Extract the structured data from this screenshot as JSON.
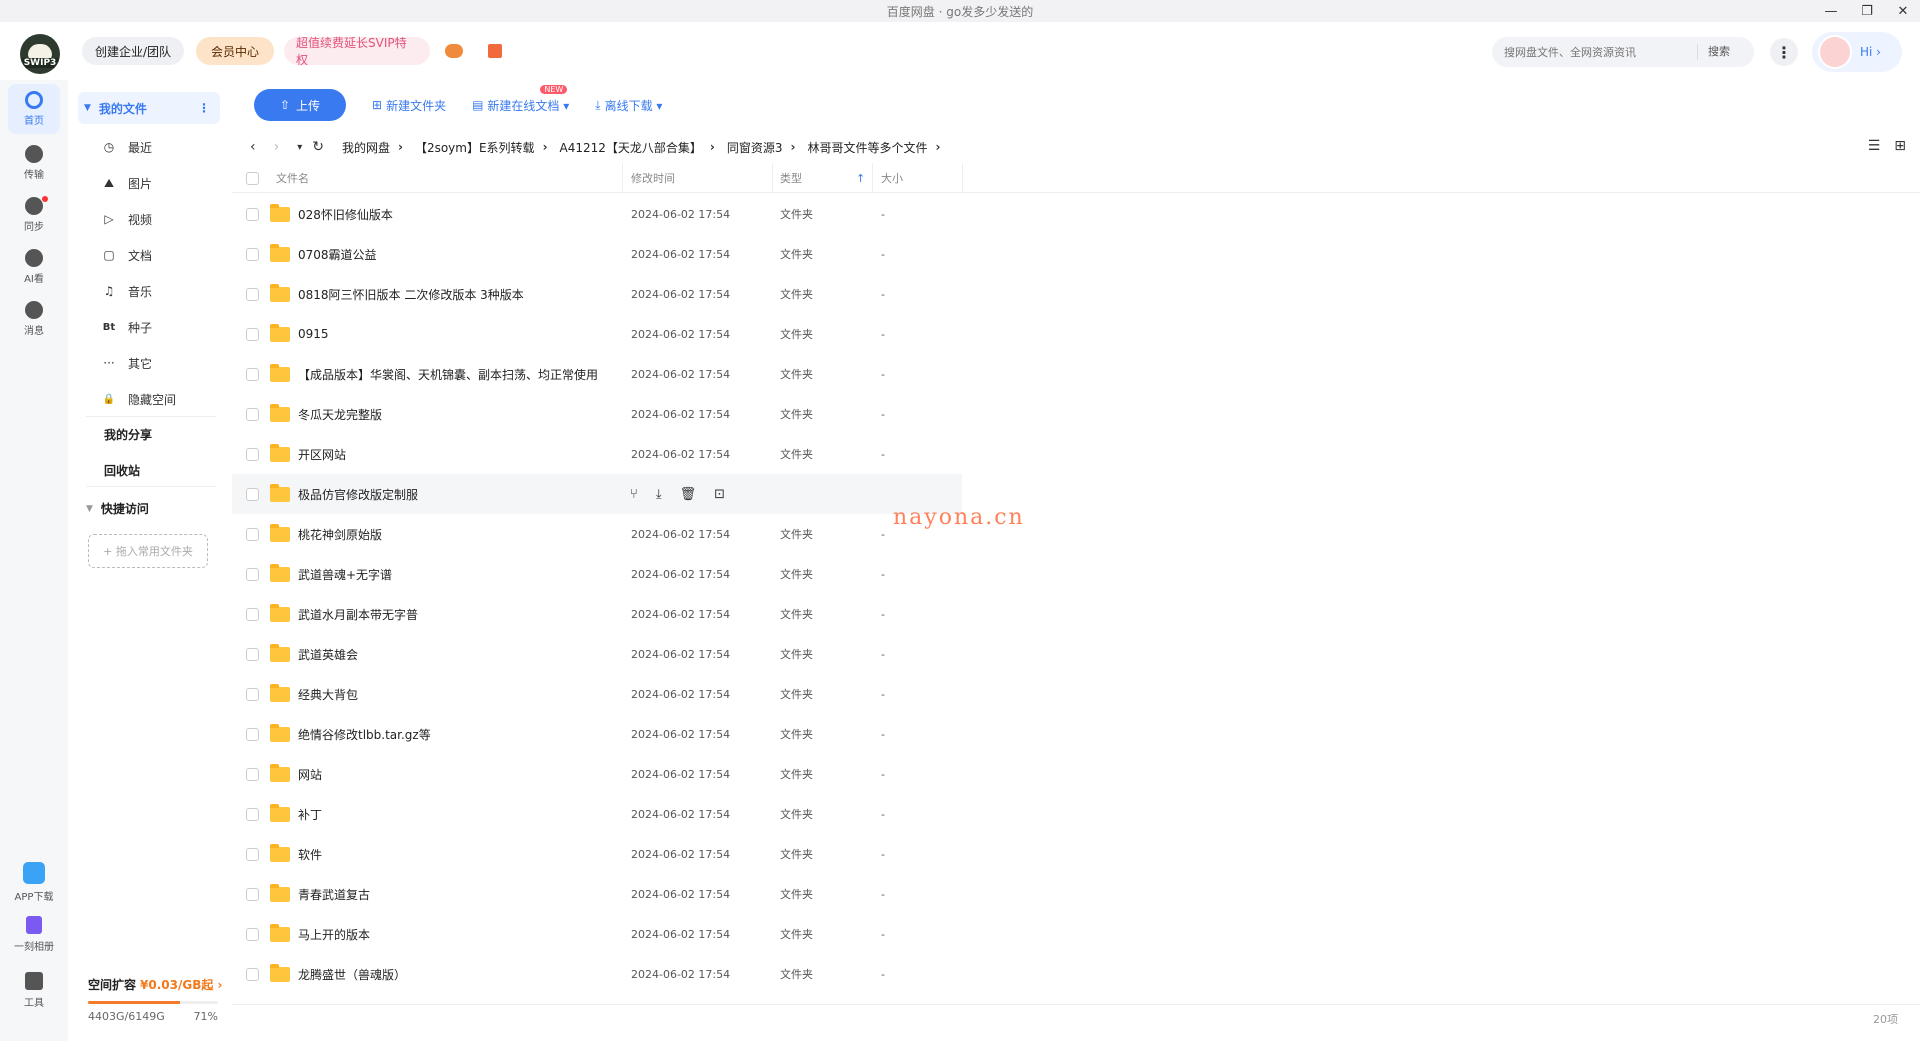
{
  "window": {
    "title": "百度网盘 · go发多少发送的",
    "controls": [
      "—",
      "❐",
      "✕"
    ]
  },
  "topbar": {
    "logo_badge": "SWIP3",
    "team_label": "创建企业/团队",
    "vip_label": "会员中心",
    "svip_label": "超值续费延长SVIP特权",
    "search_placeholder": "搜网盘文件、全网资源资讯",
    "search_button": "搜索",
    "more_icon": "⋮",
    "hi_label": "Hi ›"
  },
  "rail": {
    "items": [
      {
        "label": "首页",
        "icon": "home-icon"
      },
      {
        "label": "传输",
        "icon": "transfer-icon"
      },
      {
        "label": "同步",
        "icon": "sync-icon"
      },
      {
        "label": "AI看",
        "icon": "ai-icon"
      },
      {
        "label": "消息",
        "icon": "message-icon"
      }
    ],
    "bottom": [
      {
        "label": "APP下载",
        "icon": "app-download-icon"
      },
      {
        "label": "一刻相册",
        "icon": "album-icon"
      },
      {
        "label": "工具",
        "icon": "tools-icon"
      }
    ]
  },
  "sidebar": {
    "my_files": "我的文件",
    "categories": [
      {
        "label": "最近",
        "icon": "◷"
      },
      {
        "label": "图片",
        "icon": "⛰"
      },
      {
        "label": "视频",
        "icon": "▷"
      },
      {
        "label": "文档",
        "icon": "▢"
      },
      {
        "label": "音乐",
        "icon": "♫"
      },
      {
        "label": "种子",
        "icon": "Bt"
      },
      {
        "label": "其它",
        "icon": "···"
      },
      {
        "label": "隐藏空间",
        "icon": "🔒"
      }
    ],
    "my_share": "我的分享",
    "recycle_bin": "回收站",
    "quick_access": "快捷访问",
    "drag_hint": "+ 拖入常用文件夹",
    "storage": {
      "title": "空间扩容",
      "price": "¥0.03/GB起 ›",
      "used": "4403G/6149G",
      "percent_label": "71%",
      "percent": 71
    }
  },
  "toolbar": {
    "upload": "上传",
    "new_folder": "新建文件夹",
    "new_doc": "新建在线文档 ▾",
    "new_badge": "NEW",
    "offline_download": "离线下载 ▾"
  },
  "breadcrumb": {
    "back": "‹",
    "forward": "›",
    "dropdown": "▾",
    "refresh": "↻",
    "crumbs": [
      "我的网盘",
      "【2soym】E系列转载",
      "A41212【天龙八部合集】",
      "同窗资源3",
      "林哥哥文件等多个文件"
    ]
  },
  "table": {
    "headers": {
      "name": "文件名",
      "time": "修改时间",
      "type": "类型",
      "size": "大小",
      "sort_icon": "↑"
    },
    "rows": [
      {
        "name": "028怀旧修仙版本",
        "time": "2024-06-02 17:54",
        "type": "文件夹",
        "size": "-"
      },
      {
        "name": "0708霸道公益",
        "time": "2024-06-02 17:54",
        "type": "文件夹",
        "size": "-"
      },
      {
        "name": "0818阿三怀旧版本 二次修改版本 3种版本",
        "time": "2024-06-02 17:54",
        "type": "文件夹",
        "size": "-"
      },
      {
        "name": "0915",
        "time": "2024-06-02 17:54",
        "type": "文件夹",
        "size": "-"
      },
      {
        "name": "【成品版本】华裳阁、天机锦囊、副本扫荡、均正常使用",
        "time": "2024-06-02 17:54",
        "type": "文件夹",
        "size": "-"
      },
      {
        "name": "冬瓜天龙完整版",
        "time": "2024-06-02 17:54",
        "type": "文件夹",
        "size": "-"
      },
      {
        "name": "开区网站",
        "time": "2024-06-02 17:54",
        "type": "文件夹",
        "size": "-"
      },
      {
        "name": "极品仿官修改版定制服",
        "time": "",
        "type": "",
        "size": ""
      },
      {
        "name": "桃花神剑原始版",
        "time": "2024-06-02 17:54",
        "type": "文件夹",
        "size": "-"
      },
      {
        "name": "武道兽魂+无字谱",
        "time": "2024-06-02 17:54",
        "type": "文件夹",
        "size": "-"
      },
      {
        "name": "武道水月副本带无字普",
        "time": "2024-06-02 17:54",
        "type": "文件夹",
        "size": "-"
      },
      {
        "name": "武道英雄会",
        "time": "2024-06-02 17:54",
        "type": "文件夹",
        "size": "-"
      },
      {
        "name": "经典大背包",
        "time": "2024-06-02 17:54",
        "type": "文件夹",
        "size": "-"
      },
      {
        "name": "绝情谷修改tlbb.tar.gz等",
        "time": "2024-06-02 17:54",
        "type": "文件夹",
        "size": "-"
      },
      {
        "name": "网站",
        "time": "2024-06-02 17:54",
        "type": "文件夹",
        "size": "-"
      },
      {
        "name": "补丁",
        "time": "2024-06-02 17:54",
        "type": "文件夹",
        "size": "-"
      },
      {
        "name": "软件",
        "time": "2024-06-02 17:54",
        "type": "文件夹",
        "size": "-"
      },
      {
        "name": "青春武道复古",
        "time": "2024-06-02 17:54",
        "type": "文件夹",
        "size": "-"
      },
      {
        "name": "马上开的版本",
        "time": "2024-06-02 17:54",
        "type": "文件夹",
        "size": "-"
      },
      {
        "name": "龙腾盛世（兽魂版）",
        "time": "2024-06-02 17:54",
        "type": "文件夹",
        "size": "-"
      }
    ],
    "hover_actions": [
      "share-icon",
      "download-icon",
      "delete-icon",
      "more-icon"
    ],
    "hover_action_glyphs": [
      "⑂",
      "⤓",
      "🗑",
      "⊡"
    ]
  },
  "watermark": "nayona.cn",
  "footer": {
    "count": "20项"
  }
}
